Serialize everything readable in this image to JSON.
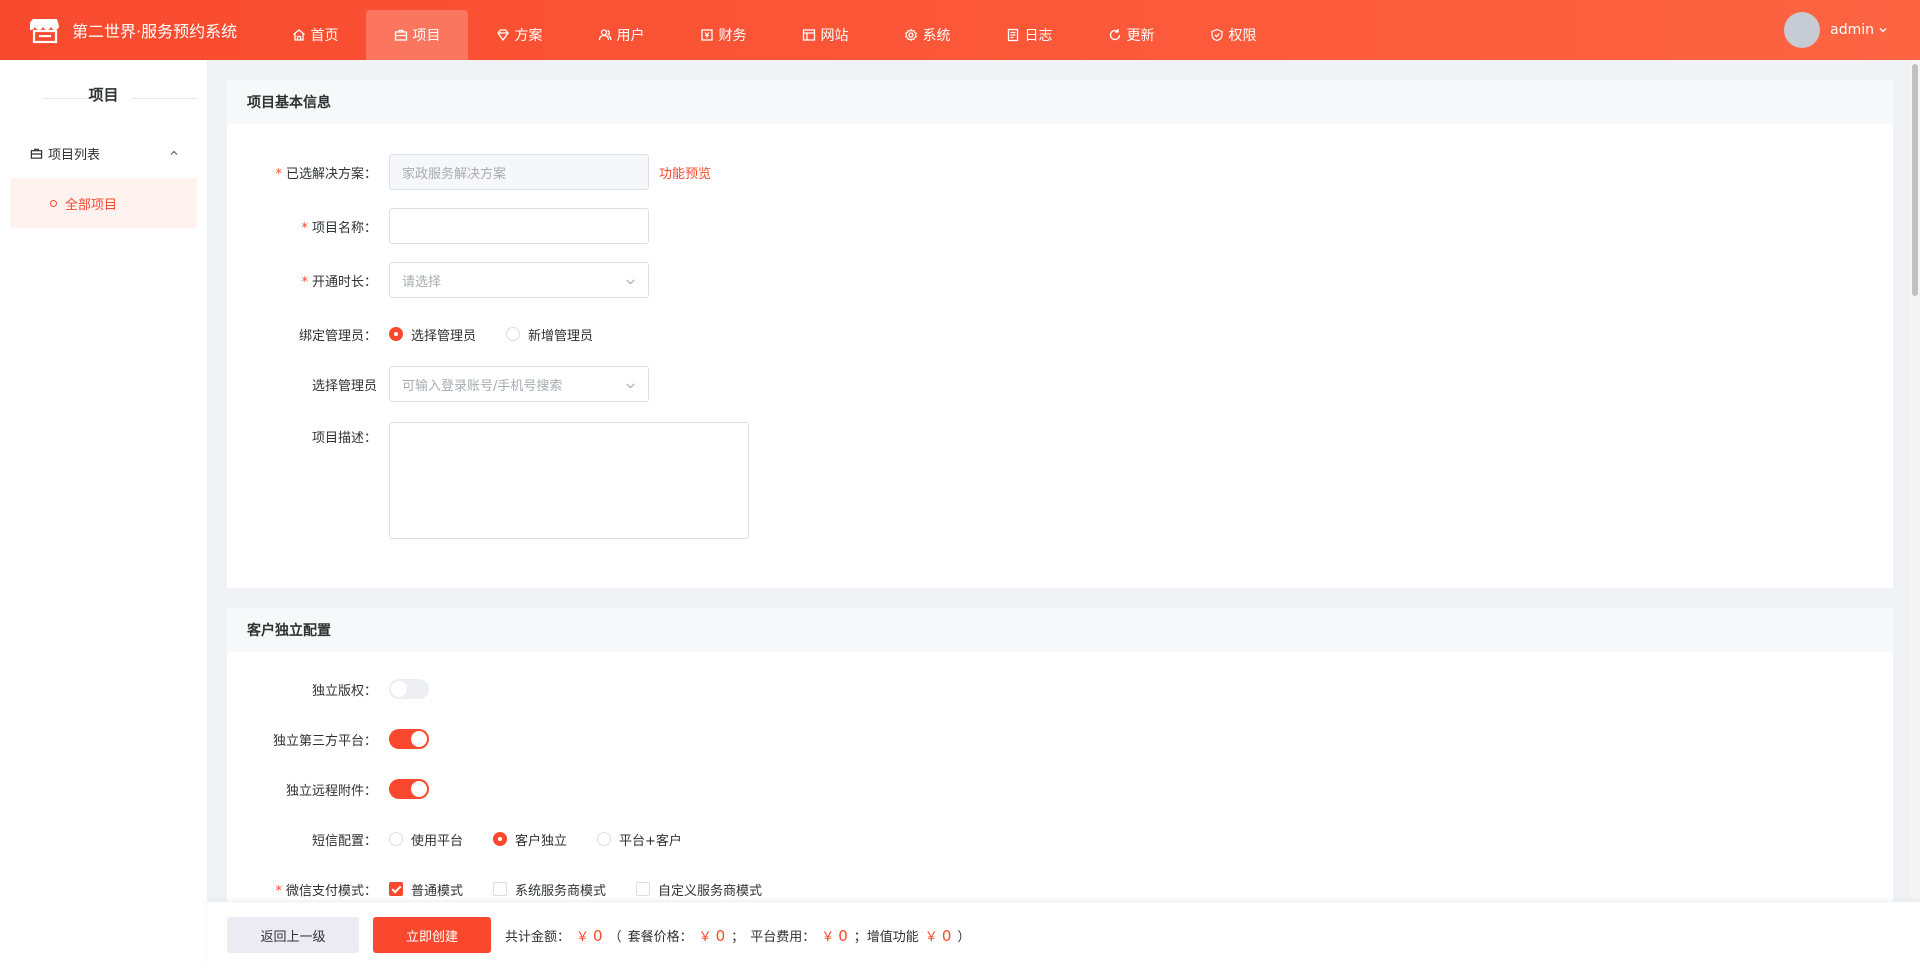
{
  "header": {
    "brand": "第二世界·服务预约系统",
    "nav": [
      {
        "label": "首页",
        "icon": "home-icon"
      },
      {
        "label": "项目",
        "icon": "briefcase-icon",
        "active": true
      },
      {
        "label": "方案",
        "icon": "diamond-icon"
      },
      {
        "label": "用户",
        "icon": "users-icon"
      },
      {
        "label": "财务",
        "icon": "finance-icon"
      },
      {
        "label": "网站",
        "icon": "layout-icon"
      },
      {
        "label": "系统",
        "icon": "gear-icon"
      },
      {
        "label": "日志",
        "icon": "log-icon"
      },
      {
        "label": "更新",
        "icon": "refresh-icon"
      },
      {
        "label": "权限",
        "icon": "shield-icon"
      }
    ],
    "user": "admin"
  },
  "sidebar": {
    "title": "项目",
    "group": "项目列表",
    "item": "全部项目"
  },
  "basic": {
    "title": "项目基本信息",
    "solution_label": "已选解决方案：",
    "solution_placeholder": "家政服务解决方案",
    "preview_link": "功能预览",
    "name_label": "项目名称：",
    "duration_label": "开通时长：",
    "duration_placeholder": "请选择",
    "admin_bind_label": "绑定管理员：",
    "admin_bind_options": [
      "选择管理员",
      "新增管理员"
    ],
    "admin_select_label": "选择管理员",
    "admin_select_placeholder": "可输入登录账号/手机号搜索",
    "desc_label": "项目描述："
  },
  "custom": {
    "title": "客户独立配置",
    "copyright_label": "独立版权：",
    "copyright_on": false,
    "third_party_label": "独立第三方平台：",
    "third_party_on": true,
    "remote_label": "独立远程附件：",
    "remote_on": true,
    "sms_label": "短信配置：",
    "sms_options": [
      "使用平台",
      "客户独立",
      "平台+客户"
    ],
    "sms_selected": "客户独立",
    "wechat_pay_label": "微信支付模式：",
    "wechat_pay_options": [
      "普通模式",
      "系统服务商模式",
      "自定义服务商模式"
    ]
  },
  "footer": {
    "back_label": "返回上一级",
    "create_label": "立即创建",
    "total_label": "共计金额：",
    "currency": "￥",
    "total": "0",
    "package_label": "套餐价格：",
    "package": "0",
    "platform_label": "平台费用：",
    "platform": "0",
    "addon_label": "增值功能",
    "addon": "0"
  },
  "colors": {
    "accent": "#f9482d",
    "header_start": "#f94a2e",
    "header_end": "#fd6442"
  }
}
